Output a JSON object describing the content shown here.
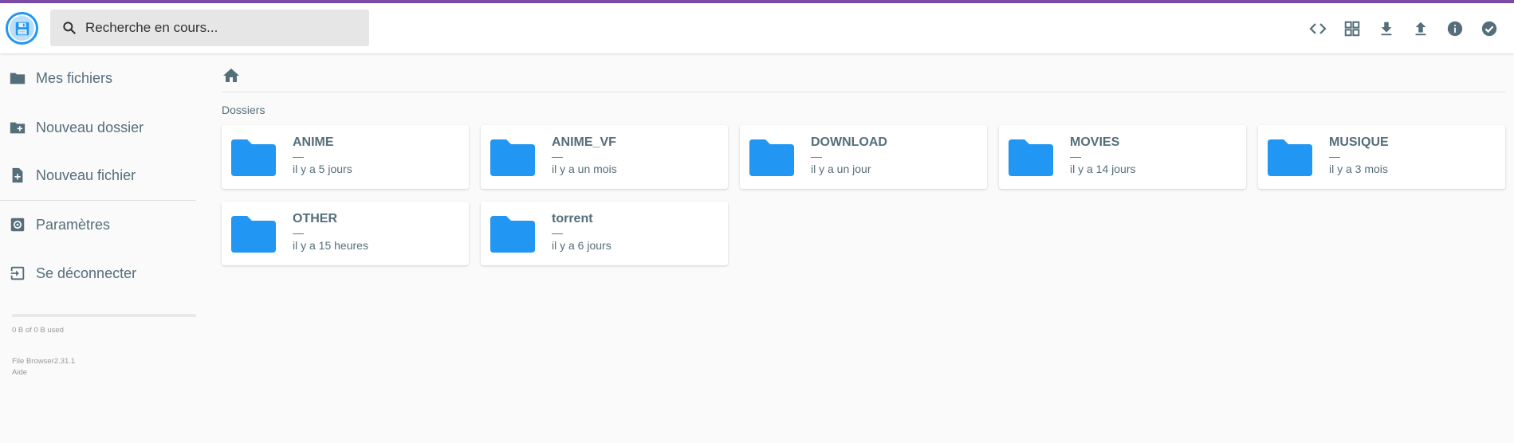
{
  "header": {
    "search_placeholder": "Recherche en cours...",
    "toolbar": [
      {
        "name": "switch-view-code-icon",
        "icon": "code"
      },
      {
        "name": "grid-view-icon",
        "icon": "grid"
      },
      {
        "name": "download-icon",
        "icon": "download"
      },
      {
        "name": "upload-icon",
        "icon": "upload"
      },
      {
        "name": "info-icon",
        "icon": "info"
      },
      {
        "name": "select-check-icon",
        "icon": "check-circle"
      }
    ]
  },
  "sidebar": {
    "items": [
      {
        "label": "Mes fichiers",
        "icon": "folder-icon"
      },
      {
        "label": "Nouveau dossier",
        "icon": "create-folder-icon"
      },
      {
        "label": "Nouveau fichier",
        "icon": "new-file-icon"
      },
      {
        "label": "Paramètres",
        "icon": "settings-icon"
      },
      {
        "label": "Se déconnecter",
        "icon": "logout-icon"
      }
    ],
    "quota": {
      "text": "0 B of 0 B used",
      "fraction": 0
    },
    "credits": {
      "app": "File Browser2.31.1",
      "help": "Aide"
    }
  },
  "main": {
    "section_title": "Dossiers",
    "folders": [
      {
        "name": "ANIME",
        "size": "—",
        "modified": "il y a 5 jours"
      },
      {
        "name": "ANIME_VF",
        "size": "—",
        "modified": "il y a un mois"
      },
      {
        "name": "DOWNLOAD",
        "size": "—",
        "modified": "il y a un jour"
      },
      {
        "name": "MOVIES",
        "size": "—",
        "modified": "il y a 14 jours"
      },
      {
        "name": "MUSIQUE",
        "size": "—",
        "modified": "il y a 3 mois"
      },
      {
        "name": "OTHER",
        "size": "—",
        "modified": "il y a 15 heures"
      },
      {
        "name": "torrent",
        "size": "—",
        "modified": "il y a 6 jours"
      }
    ]
  },
  "colors": {
    "accent": "#2196f3",
    "text": "#546e7a",
    "topline": "#7a4aa8"
  }
}
